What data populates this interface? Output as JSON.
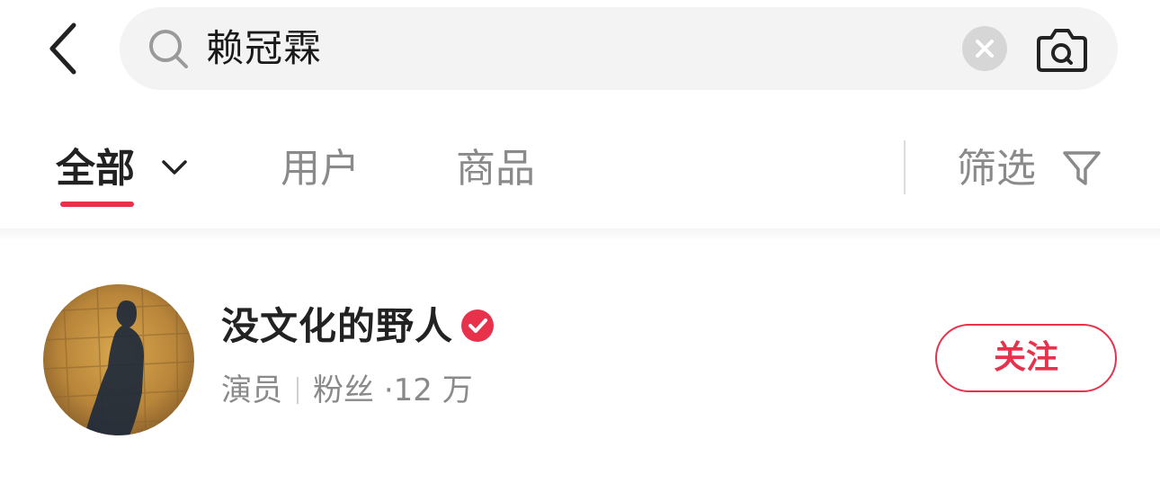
{
  "search": {
    "query": "赖冠霖"
  },
  "tabs": [
    {
      "label": "全部",
      "active": true
    },
    {
      "label": "用户",
      "active": false
    },
    {
      "label": "商品",
      "active": false
    }
  ],
  "filter": {
    "label": "筛选"
  },
  "result": {
    "name": "没文化的野人",
    "role": "演员",
    "fans_label": "粉丝",
    "fans_count": "·12 万",
    "follow_label": "关注",
    "verified": true
  },
  "colors": {
    "accent": "#e8324c",
    "search_bg": "#f3f3f3",
    "muted_text": "#8a8a8a"
  }
}
